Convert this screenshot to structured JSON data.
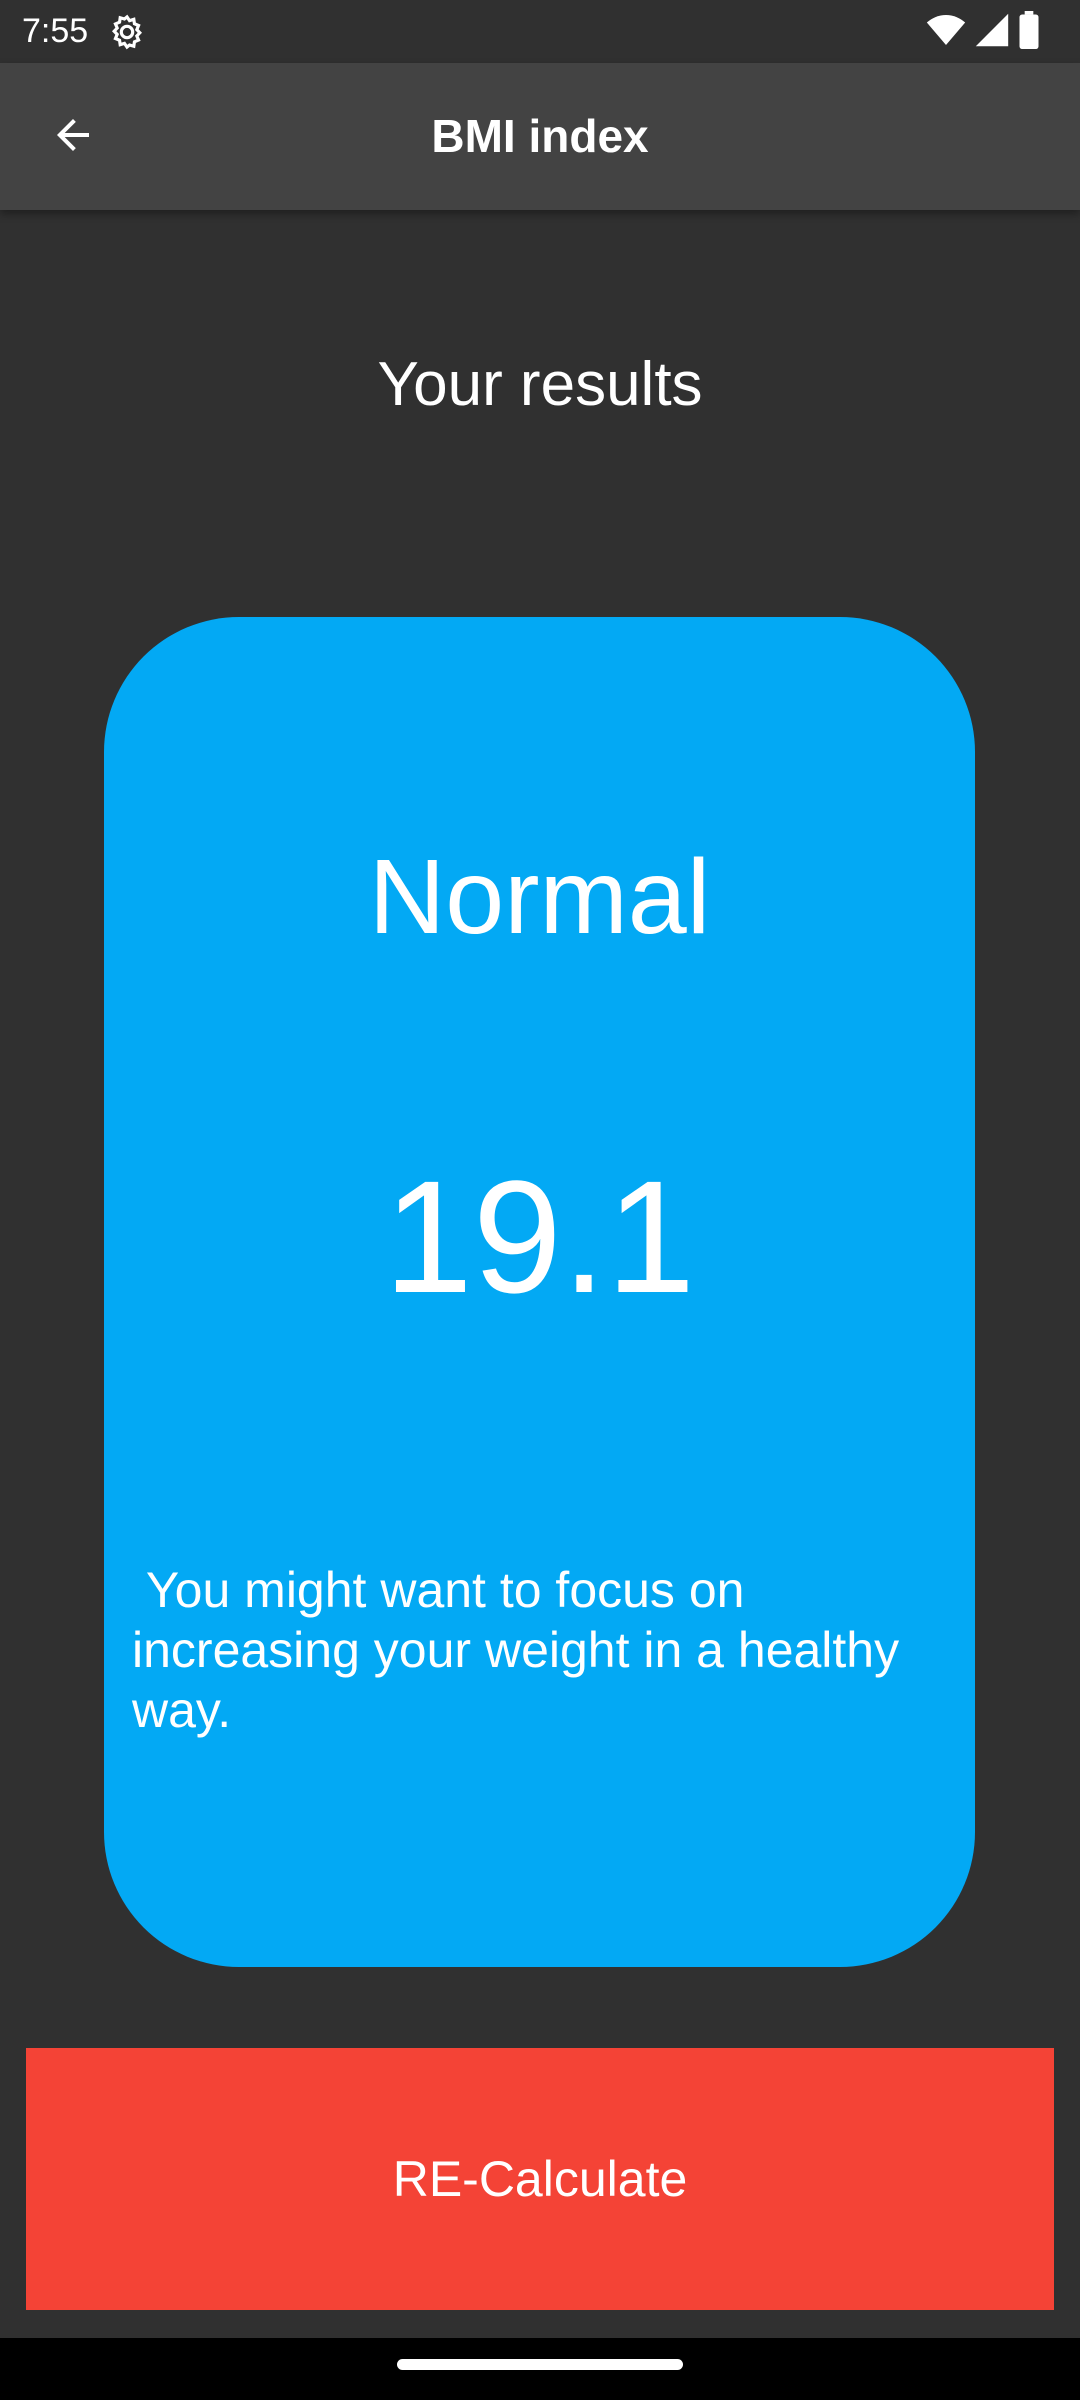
{
  "status_bar": {
    "time": "7:55",
    "icons": [
      "settings-gear-icon",
      "wifi-icon",
      "signal-icon",
      "battery-icon"
    ]
  },
  "app_bar": {
    "title": "BMI index",
    "back_icon": "arrow-back-icon"
  },
  "main": {
    "heading": "Your results",
    "result": {
      "category": "Normal",
      "bmi_value": "19.1",
      "advice": " You might want to focus on increasing your weight in a healthy way."
    },
    "recalculate_label": "RE-Calculate"
  },
  "colors": {
    "background": "#303030",
    "app_bar": "#434343",
    "card": "#03a9f4",
    "button": "#f44336",
    "text": "#ffffff"
  }
}
